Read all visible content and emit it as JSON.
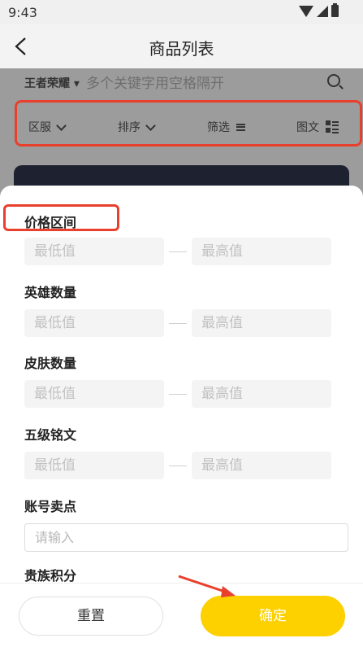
{
  "status_bar": {
    "time": "9:43"
  },
  "header": {
    "title": "商品列表"
  },
  "search": {
    "game": "王者荣耀",
    "placeholder": "多个关键字用空格隔开"
  },
  "filters": {
    "region": "区服",
    "sort": "排序",
    "filter": "筛选",
    "view": "图文"
  },
  "drawer": {
    "price_range": {
      "label": "价格区间",
      "min_placeholder": "最低值",
      "max_placeholder": "最高值"
    },
    "hero_count": {
      "label": "英雄数量",
      "min_placeholder": "最低值",
      "max_placeholder": "最高值"
    },
    "skin_count": {
      "label": "皮肤数量",
      "min_placeholder": "最低值",
      "max_placeholder": "最高值"
    },
    "inscription": {
      "label": "五级铭文",
      "min_placeholder": "最低值",
      "max_placeholder": "最高值"
    },
    "selling_points": {
      "label": "账号卖点",
      "placeholder": "请输入"
    },
    "noble_points": {
      "label": "贵族积分"
    }
  },
  "actions": {
    "reset": "重置",
    "confirm": "确定"
  },
  "colors": {
    "accent": "#fdd000",
    "highlight": "#e8402c"
  }
}
